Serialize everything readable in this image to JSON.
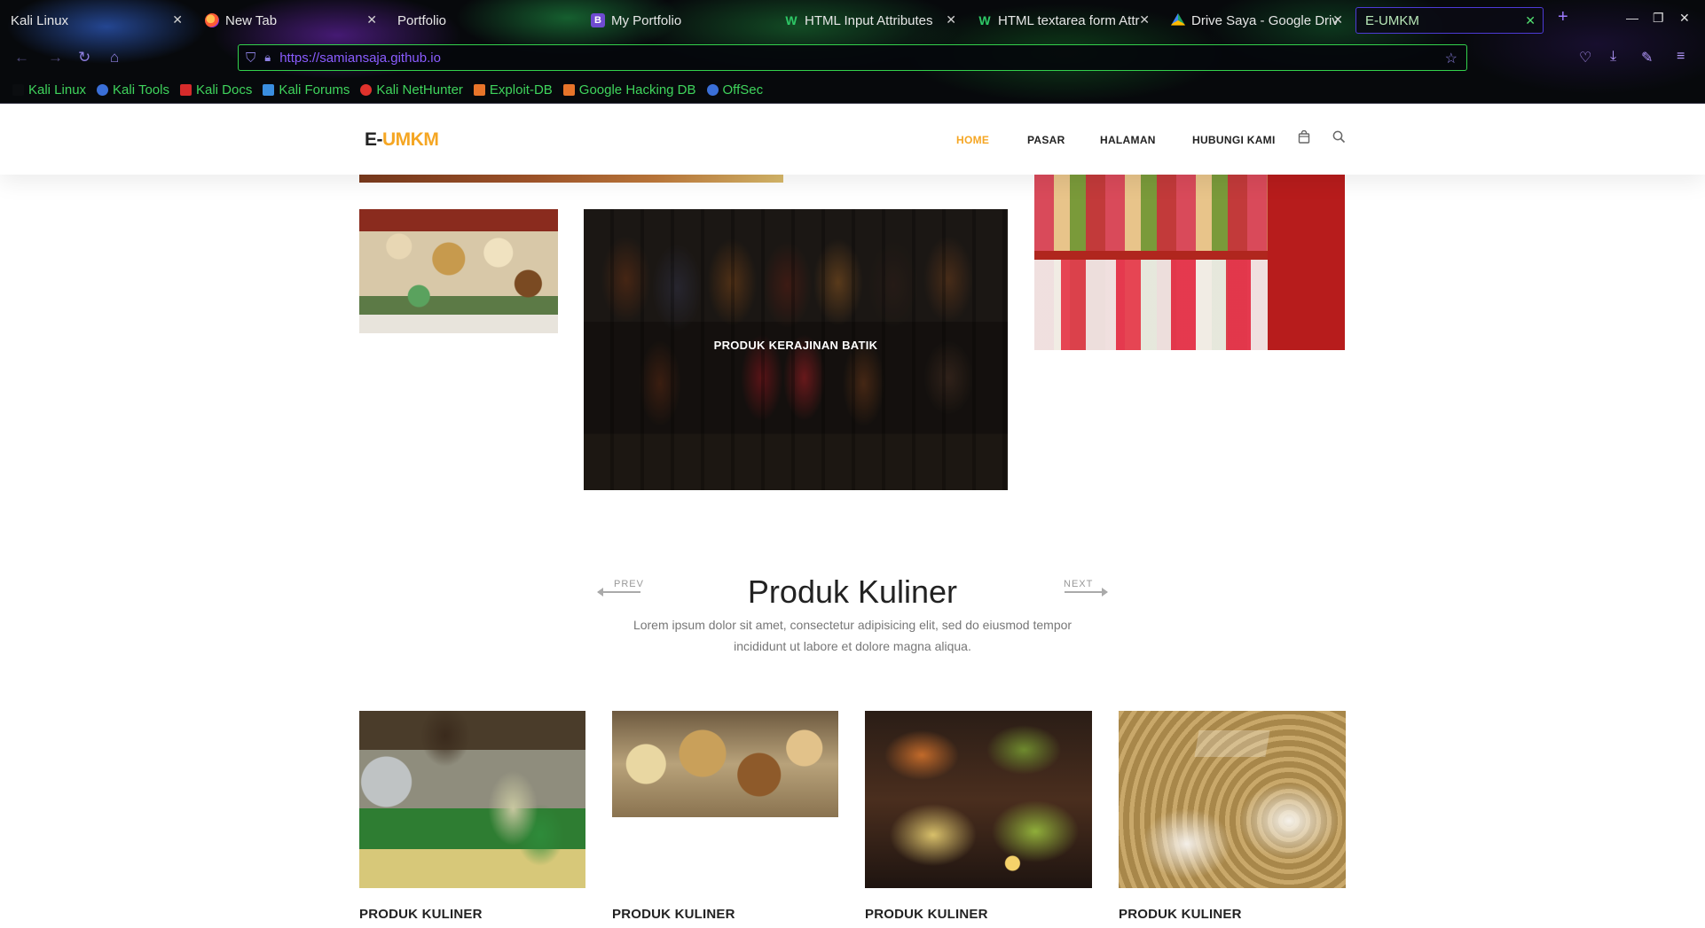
{
  "browser": {
    "tabs": [
      {
        "title": "Kali Linux",
        "icon": "kali-icon",
        "active": false
      },
      {
        "title": "New Tab",
        "icon": "firefox-icon",
        "active": false
      },
      {
        "title": "Portfolio",
        "icon": "page-icon",
        "active": false
      },
      {
        "title": "My Portfolio",
        "icon": "bootstrap-icon",
        "active": false
      },
      {
        "title": "HTML Input Attributes",
        "icon": "w3schools-icon",
        "active": false
      },
      {
        "title": "HTML textarea form Attr",
        "icon": "w3schools-icon",
        "active": false
      },
      {
        "title": "Drive Saya - Google Driv",
        "icon": "google-drive-icon",
        "active": false
      },
      {
        "title": "E-UMKM",
        "icon": "none",
        "active": true
      }
    ],
    "url": "https://samiansaja.github.io",
    "bookmarks": [
      {
        "label": "Kali Linux",
        "icon": "kali-icon"
      },
      {
        "label": "Kali Tools",
        "icon": "kali-tools-icon"
      },
      {
        "label": "Kali Docs",
        "icon": "kali-docs-icon"
      },
      {
        "label": "Kali Forums",
        "icon": "kali-forums-icon"
      },
      {
        "label": "Kali NetHunter",
        "icon": "nethunter-icon"
      },
      {
        "label": "Exploit-DB",
        "icon": "exploit-db-icon"
      },
      {
        "label": "Google Hacking DB",
        "icon": "ghdb-icon"
      },
      {
        "label": "OffSec",
        "icon": "offsec-icon"
      }
    ],
    "accent_color": "#33d14c",
    "url_color": "#8a5cff"
  },
  "site": {
    "logo_prefix": "E-",
    "logo_suffix": "UMKM",
    "logo_accent": "#f5a623",
    "menu": [
      {
        "label": "HOME",
        "active": true
      },
      {
        "label": "PASAR",
        "active": false
      },
      {
        "label": "HALAMAN",
        "active": false
      },
      {
        "label": "HUBUNGI KAMI",
        "active": false
      }
    ],
    "icons": [
      "shopping-bag-icon",
      "search-icon"
    ]
  },
  "gallery": {
    "featured_caption": "PRODUK KERAJINAN BATIK"
  },
  "section": {
    "prev": "PREV",
    "next": "NEXT",
    "title": "Produk Kuliner",
    "description": "Lorem ipsum dolor sit amet, consectetur adipisicing elit, sed do eiusmod tempor incididunt ut labore et dolore magna aliqua."
  },
  "products": [
    {
      "title": "PRODUK KULINER"
    },
    {
      "title": "PRODUK KULINER"
    },
    {
      "title": "PRODUK KULINER"
    },
    {
      "title": "PRODUK KULINER"
    }
  ]
}
